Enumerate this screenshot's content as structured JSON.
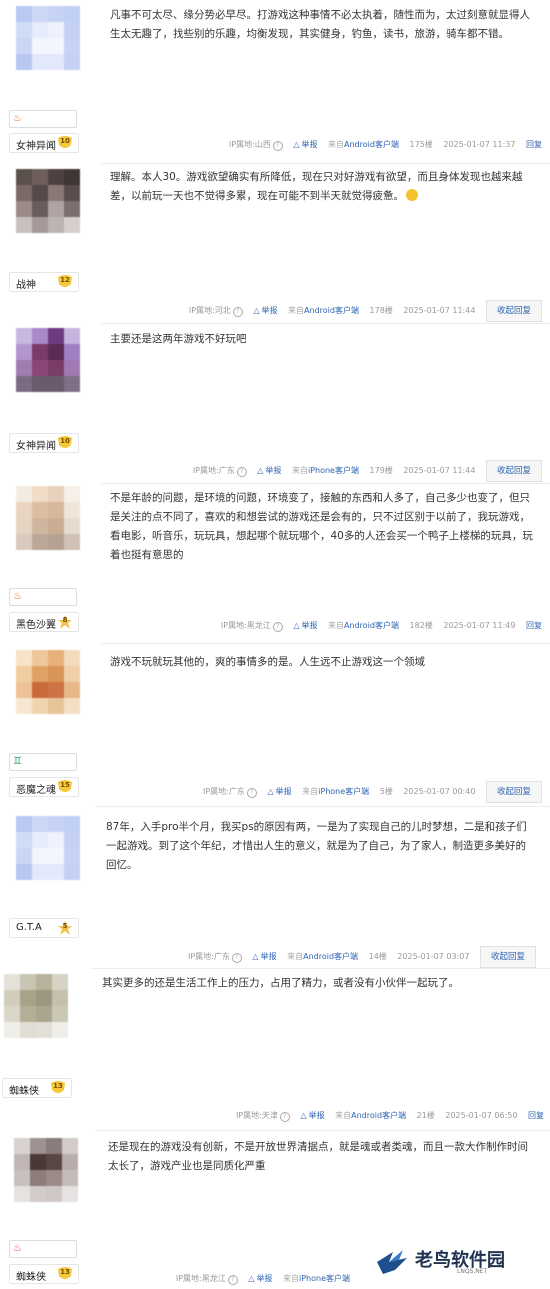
{
  "posts": [
    {
      "user": {
        "name": "女神异闻",
        "level": "10",
        "medal": true,
        "avatar_colors": [
          "#b9c9f3",
          "#cdd8f6",
          "#c7d3f5",
          "#c2cff4",
          "#d0dbf7",
          "#e6ecfb",
          "#eef2fc",
          "#c5d1f4",
          "#cbd6f6",
          "#f3f6fd",
          "#f3f6fd",
          "#c7d3f5",
          "#b7c7f2",
          "#e3e9fa",
          "#e3e9fa",
          "#c4d0f4"
        ]
      },
      "content": "凡事不可太尽、缘分势必早尽。打游戏这种事情不必太执着，随性而为，太过刻意就显得人生太无趣了，找些别的乐趣，均衡发现，其实健身，钓鱼，读书，旅游，骑车都不错。",
      "meta": {
        "ip": "IP属地:山西",
        "report": "举报",
        "client_prefix": "来自",
        "client": "Android客户端",
        "floor": "175楼",
        "time": "2025-01-07 11:37",
        "reply": "回复"
      }
    },
    {
      "user": {
        "name": "战神",
        "level": "12",
        "medal": false,
        "avatar_colors": [
          "#5c504c",
          "#6e5e5a",
          "#4e4240",
          "#3e3634",
          "#7a6a66",
          "#55494a",
          "#8a7876",
          "#5a4e4c",
          "#9a8a88",
          "#6a5c5a",
          "#b0a4a2",
          "#7c6e6c",
          "#c8c0bf",
          "#a69a98",
          "#bdb3b1",
          "#d6cfce"
        ]
      },
      "content": "理解。本人30。游戏欲望确实有所降低，现在只对好游戏有欲望，而且身体发现也越来越差，以前玩一天也不觉得多累，现在可能不到半天就觉得疲惫。",
      "meta": {
        "ip": "IP属地:河北",
        "report": "举报",
        "client_prefix": "来自",
        "client": "Android客户端",
        "floor": "178楼",
        "time": "2025-01-07 11:44",
        "reply": "收起回复"
      }
    },
    {
      "user": {
        "name": "女神异闻",
        "level": "10",
        "medal": false,
        "avatar_colors": [
          "#c9b8e0",
          "#a88ac9",
          "#6c3c7e",
          "#c6b4df",
          "#b396cf",
          "#7a3a6a",
          "#5c2a55",
          "#a080c2",
          "#a07cb0",
          "#8a4676",
          "#7a3e66",
          "#9f7ab5",
          "#7c6a80",
          "#6a5a6e",
          "#6a5a6e",
          "#7f6f84"
        ]
      },
      "content": "主要还是这两年游戏不好玩吧",
      "meta": {
        "ip": "IP属地:广东",
        "report": "举报",
        "client_prefix": "来自",
        "client": "iPhone客户端",
        "floor": "179楼",
        "time": "2025-01-07 11:44",
        "reply": "收起回复"
      }
    },
    {
      "user": {
        "name": "黑色沙翼",
        "level": "8",
        "medal": true,
        "avatar_colors": [
          "#f3ece2",
          "#f1dcc6",
          "#e8d2bd",
          "#f6f0e8",
          "#e9d4c0",
          "#dcbfa3",
          "#d6b89d",
          "#efe6da",
          "#e6d4c2",
          "#cfb79f",
          "#c9ad93",
          "#e8dccf",
          "#d8cbbe",
          "#bba898",
          "#b6a292",
          "#cfc2b4"
        ]
      },
      "content": "不是年龄的问题，是环境的问题，环境变了，接触的东西和人多了，自己多少也变了，但只是关注的点不同了，喜欢的和想尝试的游戏还是会有的，只不过区别于以前了，我玩游戏，看电影，听音乐，玩玩具，想起哪个就玩哪个，40多的人还会买一个鸭子上楼梯的玩具，玩着也挺有意思的",
      "meta": {
        "ip": "IP属地:黑龙江",
        "report": "举报",
        "client_prefix": "来自",
        "client": "Android客户端",
        "floor": "182楼",
        "time": "2025-01-07 11:49",
        "reply": "回复"
      }
    },
    {
      "user": {
        "name": "恶魔之魂",
        "level": "15",
        "medal": false,
        "avatar_colors": [
          "#f6e3c8",
          "#efc79b",
          "#e8b07a",
          "#f3dcbd",
          "#f0cca0",
          "#e1a265",
          "#d99556",
          "#efd0a8",
          "#eec197",
          "#c96a3a",
          "#cc7444",
          "#e9b88a",
          "#f7e7d0",
          "#f1d3ad",
          "#eac499",
          "#f3dfc3"
        ]
      },
      "content": "游戏不玩就玩其他的，爽的事情多的是。人生远不止游戏这一个领域",
      "meta": {
        "ip": "IP属地:广东",
        "report": "举报",
        "client_prefix": "来自",
        "client": "iPhone客户端",
        "floor": "5楼",
        "time": "2025-01-07 00:40",
        "reply": "收起回复"
      }
    },
    {
      "user": {
        "name": "G.T.A",
        "level": "5",
        "medal": false,
        "avatar_colors": [
          "#b9c9f3",
          "#cdd8f6",
          "#c7d3f5",
          "#c2cff4",
          "#d0dbf7",
          "#e6ecfb",
          "#eef2fc",
          "#c5d1f4",
          "#cbd6f6",
          "#f3f6fd",
          "#f3f6fd",
          "#c7d3f5",
          "#b7c7f2",
          "#e3e9fa",
          "#e3e9fa",
          "#c4d0f4"
        ]
      },
      "content": "87年，入手pro半个月，我买ps的原因有两，一是为了实现自己的儿时梦想，二是和孩子们一起游戏。到了这个年纪，才惜出人生的意义，就是为了自己，为了家人，制造更多美好的回忆。",
      "meta": {
        "ip": "IP属地:广东",
        "report": "举报",
        "client_prefix": "来自",
        "client": "Android客户端",
        "floor": "14楼",
        "time": "2025-01-07 03:07",
        "reply": "收起回复"
      }
    },
    {
      "user": {
        "name": "蜘蛛侠",
        "level": "13",
        "medal": false,
        "avatar_colors": [
          "#e4e2d8",
          "#c9c5b4",
          "#b7b29c",
          "#d6d3c4",
          "#d2cdbb",
          "#a8a388",
          "#9c9880",
          "#c4c0ac",
          "#d9d6c8",
          "#b4ae96",
          "#aaa58c",
          "#cbc7b5",
          "#efeee8",
          "#e0ded4",
          "#e2e0d6",
          "#efeee8"
        ]
      },
      "content": "其实更多的还是生活工作上的压力，占用了精力，或者没有小伙伴一起玩了。",
      "meta": {
        "ip": "IP属地:天津",
        "report": "举报",
        "client_prefix": "来自",
        "client": "Android客户端",
        "floor": "21楼",
        "time": "2025-01-07 06:50",
        "reply": "回复"
      }
    },
    {
      "user": {
        "name": "蜘蛛侠",
        "level": "13",
        "medal": true,
        "avatar_colors": [
          "#d8d2d0",
          "#a09290",
          "#8a7c7a",
          "#d2cbc9",
          "#c0b6b4",
          "#4a3836",
          "#5a4644",
          "#b8adab",
          "#c9c0be",
          "#8c7c7a",
          "#9a8a88",
          "#c4bab8",
          "#e6e2e1",
          "#d2cbc9",
          "#cfc8c6",
          "#e6e2e1"
        ]
      },
      "content": "还是现在的游戏没有创新，不是开放世界清据点，就是魂或者类魂，而且一款大作制作时间太长了，游戏产业也是同质化严重",
      "meta": {
        "ip": "IP属地:黑龙江",
        "report": "举报",
        "client_prefix": "来自",
        "client": "iPhone客户端",
        "floor": "",
        "time": "",
        "reply": ""
      }
    }
  ],
  "watermark": {
    "title": "老鸟软件园",
    "sub": "LNQS.NET"
  }
}
